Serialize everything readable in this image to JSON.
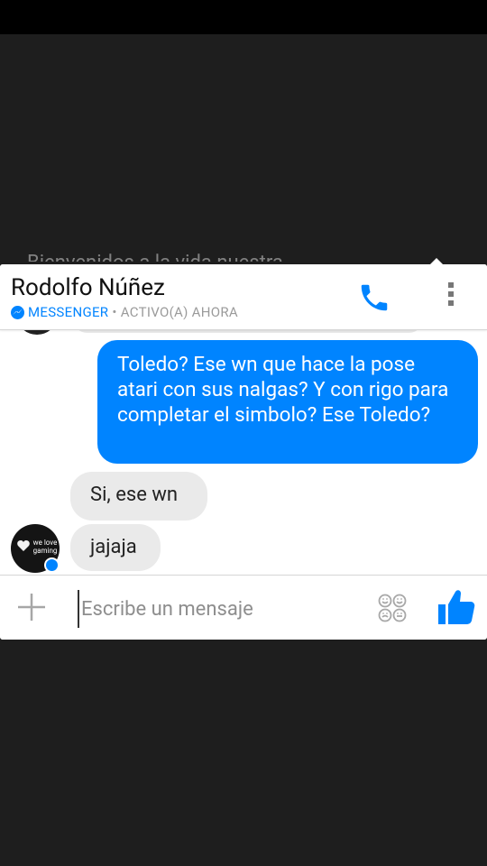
{
  "background_ghost_text": "Bienvenidos a la vida nuestra",
  "header": {
    "contact_name": "Rodolfo Núñez",
    "app_label": "MESSENGER",
    "separator": "•",
    "status": "ACTIVO(A) AHORA"
  },
  "messages": {
    "outgoing_1": "Toledo? Ese wn que hace la pose atari con sus nalgas?  Y con rigo para completar el simbolo?  Ese Toledo?",
    "incoming_1": "Si, ese wn",
    "incoming_2": "jajaja"
  },
  "avatar": {
    "logo_text": "we love gaming"
  },
  "composer": {
    "placeholder": "Escribe un mensaje"
  },
  "colors": {
    "accent": "#0084ff",
    "bubble_in": "#eaeaea",
    "backdrop": "#1e1e1e"
  }
}
